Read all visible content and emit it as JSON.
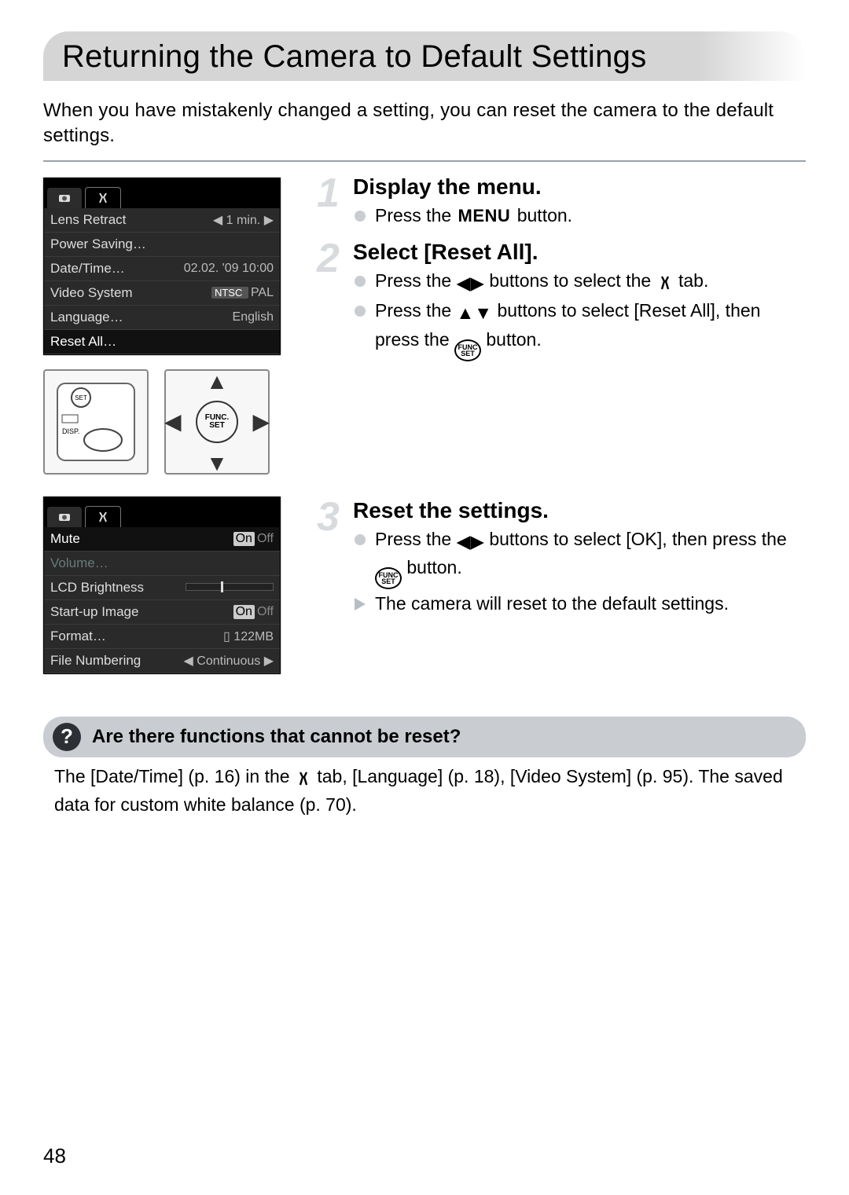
{
  "page_number": "48",
  "title": "Returning the Camera to Default Settings",
  "intro": "When you have mistakenly changed a setting, you can reset the camera to the default settings.",
  "screenshot1": {
    "rows": [
      {
        "label": "Lens Retract",
        "value_prefix": "◀",
        "value": "1 min.",
        "suffix": "▶",
        "selected": false
      },
      {
        "label": "Power Saving…",
        "value": "",
        "selected": false
      },
      {
        "label": "Date/Time…",
        "value": "02.02. '09 10:00",
        "selected": false
      },
      {
        "label": "Video System",
        "value_html": "NTSC  PAL",
        "active": "NTSC",
        "selected": false
      },
      {
        "label": "Language…",
        "value": "English",
        "selected": false
      },
      {
        "label": "Reset All…",
        "value": "",
        "selected": true
      }
    ]
  },
  "screenshot2": {
    "rows": [
      {
        "label": "Mute",
        "value_on": "On",
        "value_off": "Off",
        "active": "On",
        "selected": true
      },
      {
        "label": "Volume…",
        "value": "",
        "selected": false,
        "dim": true
      },
      {
        "label": "LCD Brightness",
        "slider": true,
        "selected": false
      },
      {
        "label": "Start-up Image",
        "value_on": "On",
        "value_off": "Off",
        "active": "On",
        "selected": false
      },
      {
        "label": "Format…",
        "value_icon": "card-icon",
        "value": "122MB",
        "selected": false
      },
      {
        "label": "File Numbering",
        "value_prefix": "◀",
        "value": "Continuous",
        "suffix": "▶",
        "selected": false
      }
    ]
  },
  "steps": {
    "s1": {
      "num": "1",
      "title": "Display the menu.",
      "b1a": "Press the ",
      "b1b": "MENU",
      "b1c": " button."
    },
    "s2": {
      "num": "2",
      "title": "Select [Reset All].",
      "b1a": "Press the ",
      "b1b": " buttons to select the ",
      "b1c": " tab.",
      "b2a": "Press the ",
      "b2b": " buttons to select [Reset All], then press the ",
      "b2c": " button."
    },
    "s3": {
      "num": "3",
      "title": "Reset the settings.",
      "b1a": "Press the ",
      "b1b": " buttons to select [OK], then press the ",
      "b1c": " button.",
      "b2": "The camera will reset to the default settings."
    }
  },
  "note": {
    "heading": "Are there functions that cannot be reset?",
    "body_a": "The [Date/Time] (p. 16) in the ",
    "body_b": " tab, [Language] (p. 18), [Video System] (p. 95). The saved data for custom white balance (p. 70)."
  },
  "icons": {
    "lr_arrows": "◀▶",
    "ud_arrows": "▲▼",
    "tools": "🛠",
    "camera": "📷",
    "funcset": "FUNC. SET",
    "card": "🗂"
  }
}
